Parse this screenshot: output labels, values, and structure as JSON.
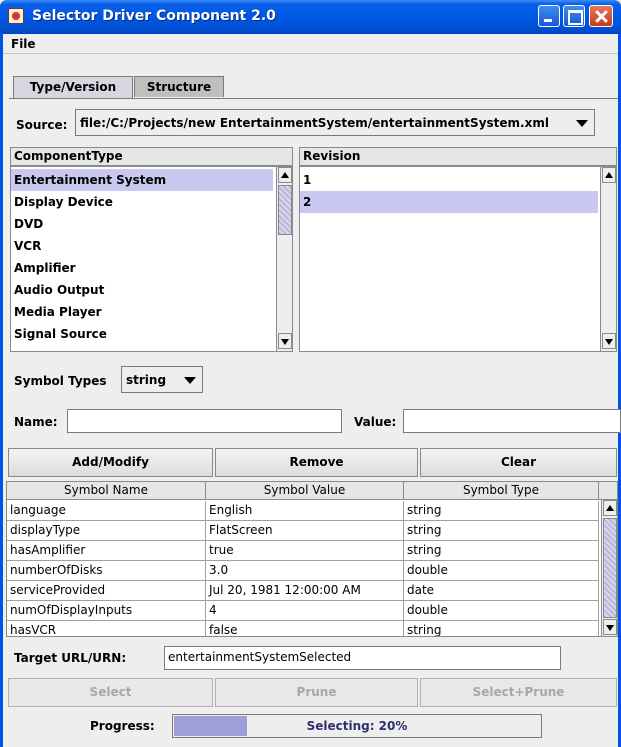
{
  "window": {
    "title": "Selector Driver Component 2.0"
  },
  "menu": {
    "file": "File"
  },
  "tabs": [
    {
      "label": "Type/Version",
      "active": true
    },
    {
      "label": "Structure",
      "active": false
    }
  ],
  "source": {
    "label": "Source:",
    "value": "file:/C:/Projects/new EntertainmentSystem/entertainmentSystem.xml"
  },
  "component_list": {
    "header": "ComponentType",
    "items": [
      "Entertainment System",
      "Display Device",
      "DVD",
      "VCR",
      "Amplifier",
      "Audio Output",
      "Media Player",
      "Signal Source"
    ],
    "selected": "Entertainment System"
  },
  "revision_list": {
    "header": "Revision",
    "items": [
      "1",
      "2"
    ],
    "selected": "2"
  },
  "symbol_types": {
    "label": "Symbol Types",
    "value": "string"
  },
  "name_field": {
    "label": "Name:",
    "value": ""
  },
  "value_field": {
    "label": "Value:",
    "value": ""
  },
  "buttons": {
    "add_modify": "Add/Modify",
    "remove": "Remove",
    "clear": "Clear"
  },
  "symbol_table": {
    "columns": [
      "Symbol Name",
      "Symbol Value",
      "Symbol Type"
    ],
    "rows": [
      [
        "language",
        "English",
        "string"
      ],
      [
        "displayType",
        "FlatScreen",
        "string"
      ],
      [
        "hasAmplifier",
        "true",
        "string"
      ],
      [
        "numberOfDisks",
        "3.0",
        "double"
      ],
      [
        "serviceProvided",
        "Jul 20, 1981 12:00:00 AM",
        "date"
      ],
      [
        "numOfDisplayInputs",
        "4",
        "double"
      ],
      [
        "hasVCR",
        "false",
        "string"
      ]
    ]
  },
  "target": {
    "label": "Target URL/URN:",
    "value": "entertainmentSystemSelected"
  },
  "action_buttons": {
    "select": "Select",
    "prune": "Prune",
    "select_prune": "Select+Prune"
  },
  "progress": {
    "label": "Progress:",
    "text": "Selecting: 20%",
    "fraction": 0.2
  },
  "colors": {
    "selection": "#c8c8f0",
    "progress_fill": "#9e9ed8",
    "titlebar": "#0054e3"
  }
}
